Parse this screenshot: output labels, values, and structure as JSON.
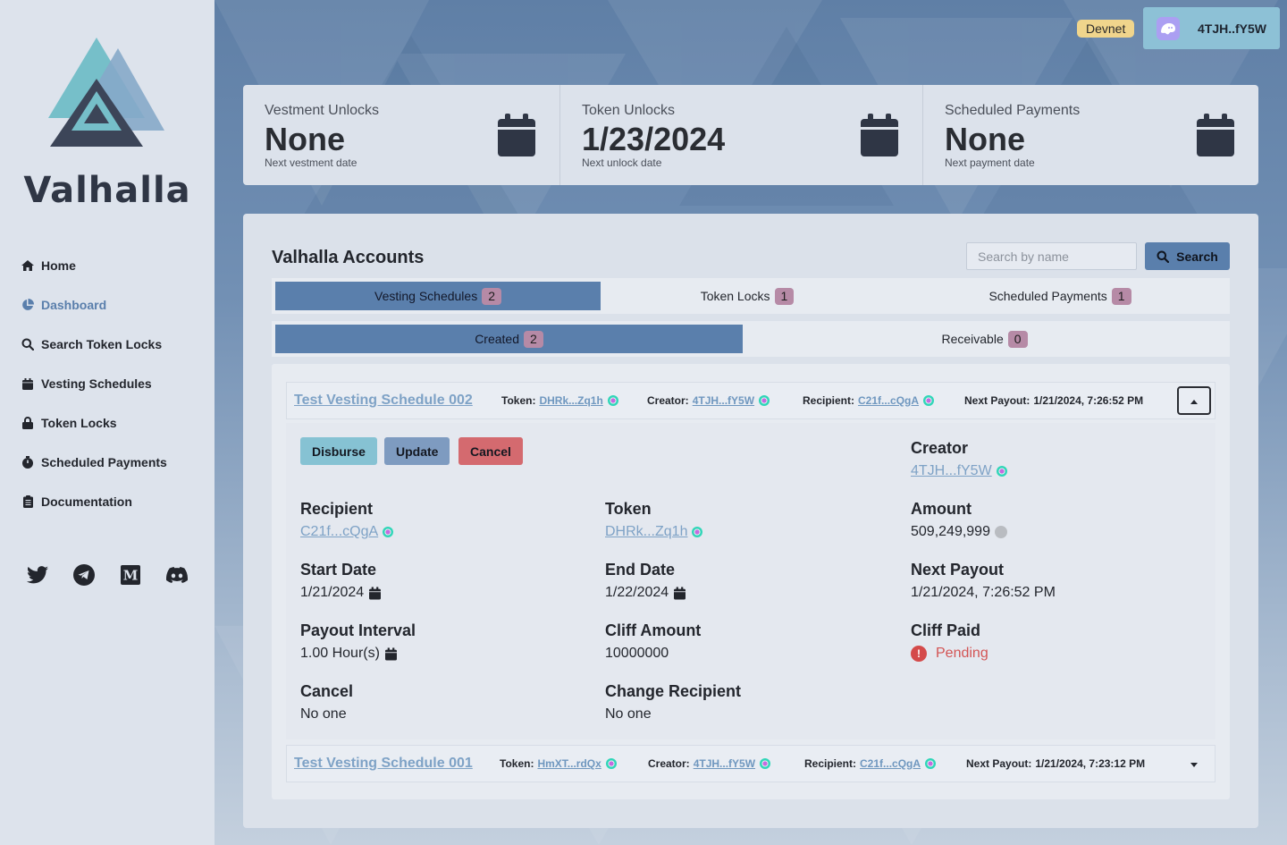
{
  "app": {
    "brand": "Valhalla"
  },
  "sidebar": {
    "items": [
      {
        "label": "Home",
        "icon": "home-icon"
      },
      {
        "label": "Dashboard",
        "icon": "pie-chart-icon"
      },
      {
        "label": "Search Token Locks",
        "icon": "search-icon"
      },
      {
        "label": "Vesting Schedules",
        "icon": "calendar-icon"
      },
      {
        "label": "Token Locks",
        "icon": "lock-icon"
      },
      {
        "label": "Scheduled Payments",
        "icon": "stopwatch-icon"
      },
      {
        "label": "Documentation",
        "icon": "clipboard-icon"
      }
    ],
    "active": "Dashboard",
    "socials": [
      "twitter-icon",
      "telegram-icon",
      "medium-icon",
      "discord-icon"
    ]
  },
  "topbar": {
    "network": "Devnet",
    "wallet": "4TJH..fY5W"
  },
  "stats": [
    {
      "label": "Vestment Unlocks",
      "value": "None",
      "sub": "Next vestment date"
    },
    {
      "label": "Token Unlocks",
      "value": "1/23/2024",
      "sub": "Next unlock date"
    },
    {
      "label": "Scheduled Payments",
      "value": "None",
      "sub": "Next payment date"
    }
  ],
  "panel": {
    "title": "Valhalla Accounts",
    "search_placeholder": "Search by name",
    "search_label": "Search",
    "tabs": [
      {
        "label": "Vesting Schedules",
        "count": "2"
      },
      {
        "label": "Token Locks",
        "count": "1"
      },
      {
        "label": "Scheduled Payments",
        "count": "1"
      }
    ],
    "subtabs": [
      {
        "label": "Created",
        "count": "2"
      },
      {
        "label": "Receivable",
        "count": "0"
      }
    ]
  },
  "schedules": [
    {
      "name": "Test Vesting Schedule 002",
      "token_label": "Token:",
      "token": "DHRk...Zq1h",
      "creator_label": "Creator:",
      "creator": "4TJH...fY5W",
      "recipient_label": "Recipient:",
      "recipient": "C21f...cQgA",
      "next_label": "Next Payout:",
      "next": "1/21/2024, 7:26:52 PM"
    },
    {
      "name": "Test Vesting Schedule 001",
      "token_label": "Token:",
      "token": "HmXT...rdQx",
      "creator_label": "Creator:",
      "creator": "4TJH...fY5W",
      "recipient_label": "Recipient:",
      "recipient": "C21f...cQgA",
      "next_label": "Next Payout:",
      "next": "1/21/2024, 7:23:12 PM"
    }
  ],
  "details": {
    "buttons": {
      "disburse": "Disburse",
      "update": "Update",
      "cancel": "Cancel"
    },
    "colors": {
      "disburse": "#86c2d3",
      "update": "#7e9bc0",
      "cancel": "#d46a6f"
    },
    "creator": {
      "label": "Creator",
      "value": "4TJH...fY5W"
    },
    "recipient": {
      "label": "Recipient",
      "value": "C21f...cQgA"
    },
    "token": {
      "label": "Token",
      "value": "DHRk...Zq1h"
    },
    "amount": {
      "label": "Amount",
      "value": "509,249,999"
    },
    "start": {
      "label": "Start Date",
      "value": "1/21/2024"
    },
    "end": {
      "label": "End Date",
      "value": "1/22/2024"
    },
    "next_payout": {
      "label": "Next Payout",
      "value": "1/21/2024, 7:26:52 PM"
    },
    "interval": {
      "label": "Payout Interval",
      "value": "1.00 Hour(s)"
    },
    "cliff_amount": {
      "label": "Cliff Amount",
      "value": "10000000"
    },
    "cliff_paid": {
      "label": "Cliff Paid",
      "value": "Pending"
    },
    "cancel": {
      "label": "Cancel",
      "value": "No one"
    },
    "change_recipient": {
      "label": "Change Recipient",
      "value": "No one"
    }
  }
}
